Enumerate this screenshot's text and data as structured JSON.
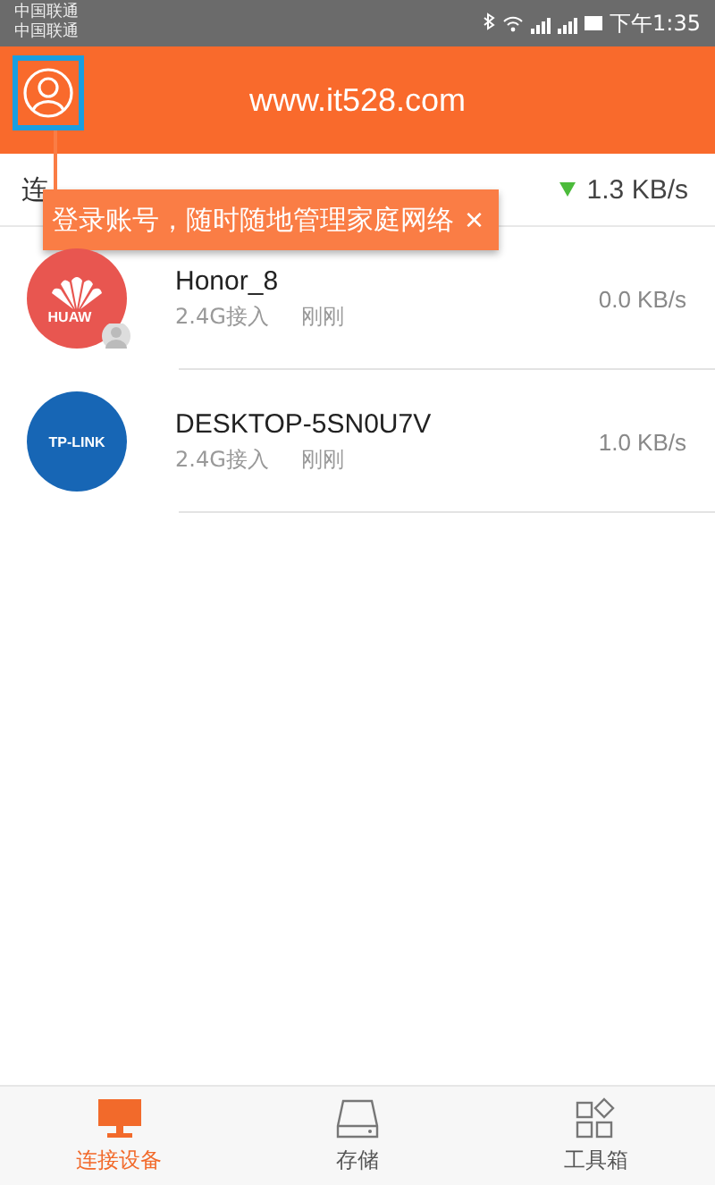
{
  "status_bar": {
    "carriers": [
      "中国联通",
      "中国联通"
    ],
    "time": "下午1:35"
  },
  "header": {
    "title": "www.it528.com"
  },
  "summary": {
    "label": "连",
    "download_speed": "1.3 KB/s"
  },
  "tooltip": {
    "text": "登录账号，随时随地管理家庭网络",
    "close": "×"
  },
  "devices": [
    {
      "name": "Honor_8",
      "band": "2.4G接入",
      "time": "刚刚",
      "speed": "0.0 KB/s",
      "kind": "huawei",
      "logo_text": "HUAW"
    },
    {
      "name": "DESKTOP-5SN0U7V",
      "band": "2.4G接入",
      "time": "刚刚",
      "speed": "1.0 KB/s",
      "kind": "tplink",
      "logo_text": "TP-LINK"
    }
  ],
  "nav": [
    {
      "label": "连接设备",
      "kind": "devices",
      "selected": true
    },
    {
      "label": "存储",
      "kind": "storage",
      "selected": false
    },
    {
      "label": "工具箱",
      "kind": "tools",
      "selected": false
    }
  ]
}
